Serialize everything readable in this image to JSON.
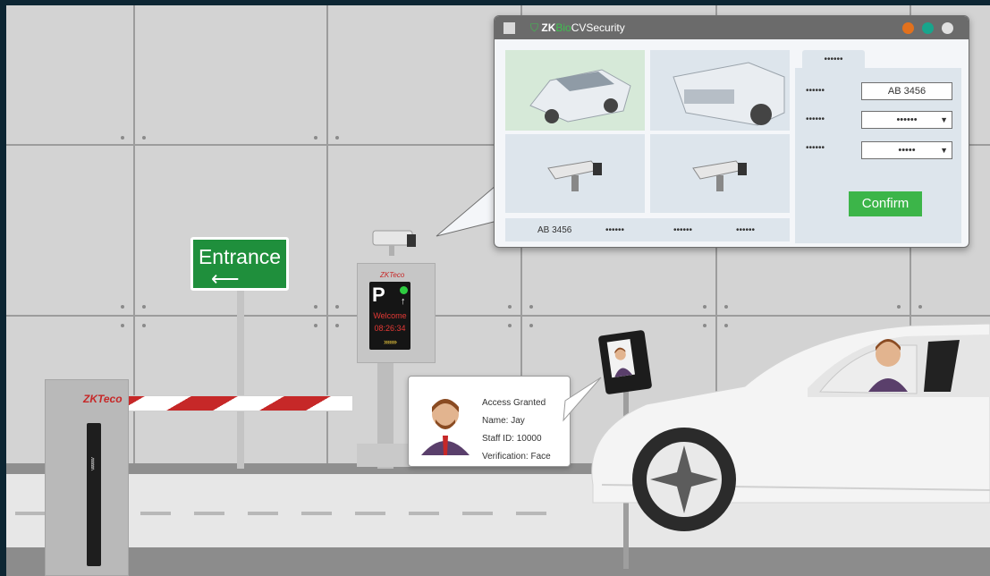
{
  "sign": {
    "label": "Entrance",
    "arrow": "⟵"
  },
  "gate": {
    "brand": "ZKTeco",
    "arrows": "^^^^^^"
  },
  "kiosk": {
    "brand": "ZKTeco",
    "letter": "P",
    "welcome": "Welcome",
    "time": "08:26:34",
    "chevrons": "›››››››"
  },
  "access_card": {
    "status": "Access Granted",
    "name": "Name: Jay",
    "staff_id": "Staff ID: 10000",
    "verification": "Verification: Face"
  },
  "window": {
    "brand_zk": "ZK",
    "brand_bio": "Bio",
    "brand_rest": "CVSecurity",
    "window_dots": [
      "#e2711d",
      "#18a58c",
      "#e0e0e0"
    ],
    "tab_label": "••••••",
    "plate_value": "AB 3456",
    "row_labels": [
      "••••••",
      "••••••",
      "••••••"
    ],
    "select_1": "••••••",
    "select_2": "•••••",
    "select_caret": "▼",
    "confirm_label": "Confirm",
    "plates_row": [
      "AB 3456",
      "••••••",
      "••••••",
      "••••••"
    ]
  },
  "colors": {
    "brand_green": "#3cb549",
    "accent_red": "#c62828",
    "background": "#0d2633"
  }
}
